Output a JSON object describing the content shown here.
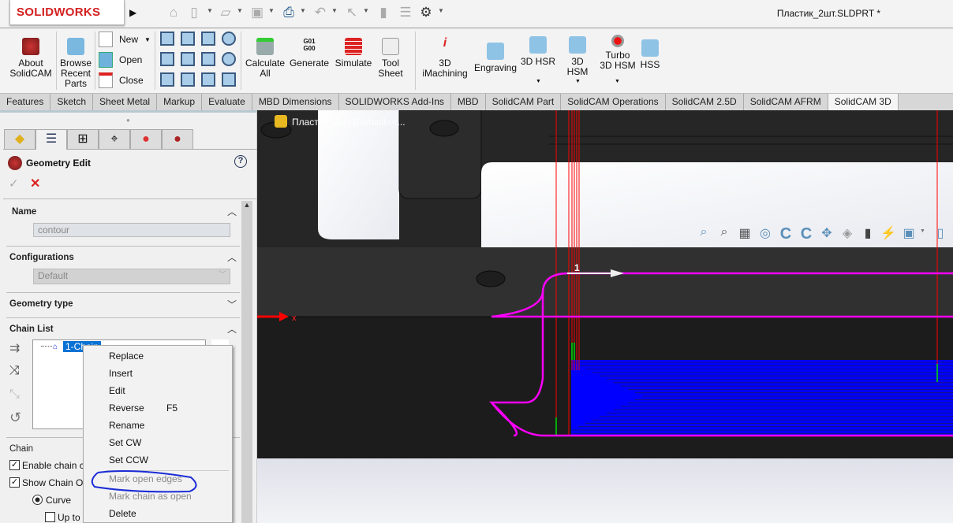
{
  "app": {
    "logo_text": "SOLIDWORKS",
    "document_title": "Пластик_2шт.SLDPRT *"
  },
  "ribbon": {
    "about": "About SolidCAM",
    "browse": "Browse Recent Parts",
    "new": "New",
    "open": "Open",
    "close": "Close",
    "calculate": "Calculate All",
    "generate": "Generate",
    "generate_icon_text": "G01 G00",
    "simulate": "Simulate",
    "tool_sheet": "Tool Sheet",
    "imachining": "3D iMachining",
    "engraving": "Engraving",
    "hsr": "3D HSR",
    "hsm": "3D HSM",
    "turbo": "Turbo 3D HSM",
    "hss": "HSS"
  },
  "tabs": [
    "Features",
    "Sketch",
    "Sheet Metal",
    "Markup",
    "Evaluate",
    "MBD Dimensions",
    "SOLIDWORKS Add-Ins",
    "MBD",
    "SolidCAM Part",
    "SolidCAM Operations",
    "SolidCAM 2.5D",
    "SolidCAM AFRM",
    "SolidCAM 3D"
  ],
  "active_tab": "SolidCAM 3D",
  "panel": {
    "title": "Geometry Edit",
    "name_label": "Name",
    "name_value": "contour",
    "config_label": "Configurations",
    "config_value": "Default",
    "geom_type_label": "Geometry type",
    "chain_list_label": "Chain List",
    "chain_item": "1-Chain",
    "chain_label": "Chain",
    "enable_chain": "Enable chain c",
    "show_chain": "Show Chain O",
    "curve": "Curve",
    "up_to": "Up to"
  },
  "context_menu": {
    "items": [
      {
        "label": "Replace",
        "enabled": true
      },
      {
        "label": "Insert",
        "enabled": true
      },
      {
        "label": "Edit",
        "enabled": true
      },
      {
        "label": "Reverse",
        "shortcut": "F5",
        "enabled": true
      },
      {
        "label": "Rename",
        "enabled": true
      },
      {
        "label": "Set CW",
        "enabled": true
      },
      {
        "label": "Set CCW",
        "enabled": true
      },
      {
        "label": "Mark open edges",
        "enabled": false,
        "highlighted": true
      },
      {
        "label": "Mark chain as open",
        "enabled": false
      },
      {
        "label": "Delete",
        "enabled": true
      }
    ]
  },
  "viewport": {
    "doc_label": "Пластик_2шт  (Default<<...",
    "chain_number": "1",
    "axis_label": "x",
    "colors": {
      "toolpath": "#0000ff",
      "contour": "#ff00ff",
      "lines": "#ff0000",
      "annotation": "#1a2bd6"
    }
  }
}
